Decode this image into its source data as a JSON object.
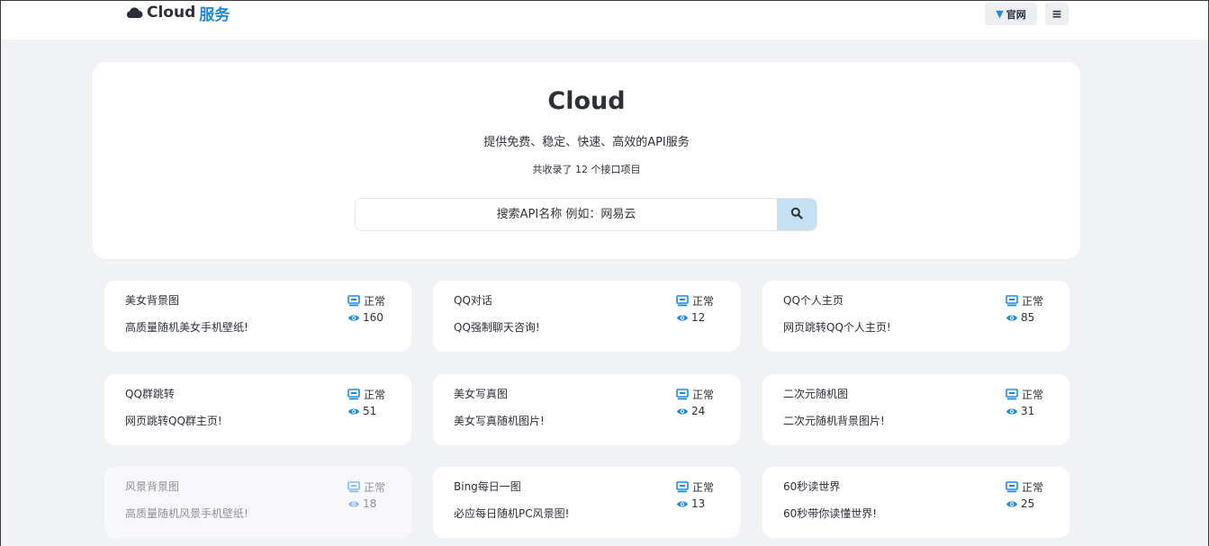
{
  "navbar": {
    "brand_main": "Cloud",
    "brand_accent": "服务",
    "official_label": "官网",
    "menu_icon": "menu-icon",
    "accent_color": "#1e88e5"
  },
  "hero": {
    "title": "Cloud",
    "subtitle": "提供免费、稳定、快速、高效的API服务",
    "count_text": "共收录了 12 个接口项目"
  },
  "search": {
    "placeholder": "搜索API名称 例如：网易云",
    "button_icon": "search-icon",
    "button_color": "#c4e0f2"
  },
  "cards": [
    {
      "title": "美女背景图",
      "desc": "高质量随机美女手机壁纸!",
      "status": "正常",
      "views": "160"
    },
    {
      "title": "QQ对话",
      "desc": "QQ强制聊天咨询!",
      "status": "正常",
      "views": "12"
    },
    {
      "title": "QQ个人主页",
      "desc": "网页跳转QQ个人主页!",
      "status": "正常",
      "views": "85"
    },
    {
      "title": "QQ群跳转",
      "desc": "网页跳转QQ群主页!",
      "status": "正常",
      "views": "51"
    },
    {
      "title": "美女写真图",
      "desc": "美女写真随机图片!",
      "status": "正常",
      "views": "24"
    },
    {
      "title": "二次元随机图",
      "desc": "二次元随机背景图片!",
      "status": "正常",
      "views": "31"
    },
    {
      "title": "风景背景图",
      "desc": "高质量随机风景手机壁纸!",
      "status": "正常",
      "views": "18"
    },
    {
      "title": "Bing每日一图",
      "desc": "必应每日随机PC风景图!",
      "status": "正常",
      "views": "13"
    },
    {
      "title": "60秒读世界",
      "desc": "60秒带你读懂世界!",
      "status": "正常",
      "views": "25"
    }
  ]
}
